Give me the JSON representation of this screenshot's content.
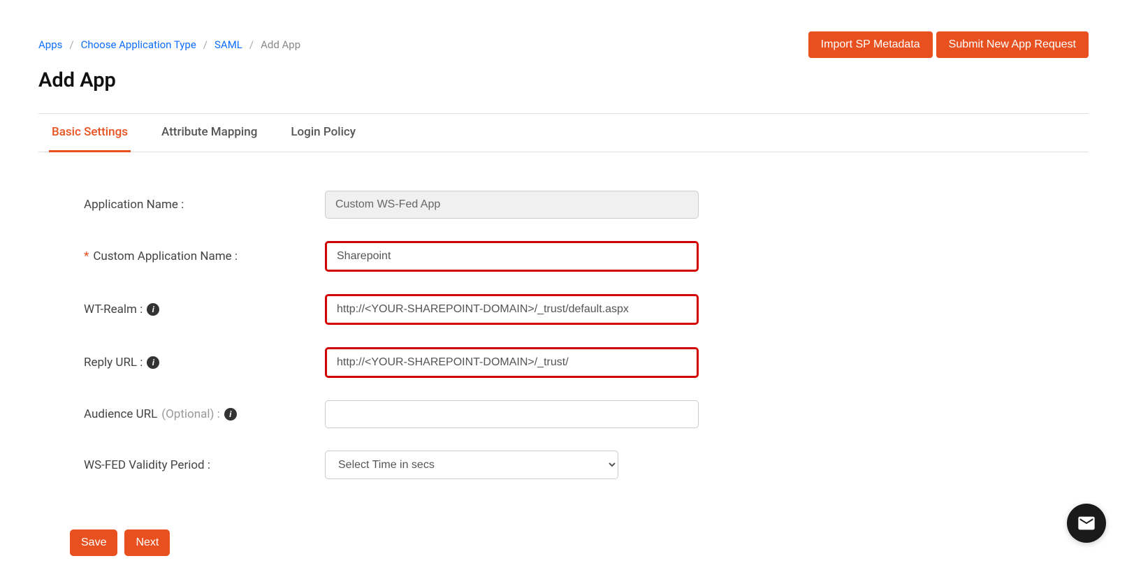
{
  "breadcrumb": {
    "apps": "Apps",
    "choose_type": "Choose Application Type",
    "saml": "SAML",
    "add_app": "Add App"
  },
  "top_buttons": {
    "import_sp": "Import SP Metadata",
    "submit_new": "Submit New App Request"
  },
  "page_title": "Add App",
  "tabs": {
    "basic": "Basic Settings",
    "attribute": "Attribute Mapping",
    "login": "Login Policy"
  },
  "form": {
    "app_name_label": "Application Name :",
    "app_name_value": "Custom WS-Fed App",
    "custom_app_name_label": "Custom Application Name :",
    "custom_app_name_value": "Sharepoint",
    "wt_realm_label": "WT-Realm :",
    "wt_realm_value": "http://<YOUR-SHAREPOINT-DOMAIN>/_trust/default.aspx",
    "reply_url_label": "Reply URL :",
    "reply_url_value": "http://<YOUR-SHAREPOINT-DOMAIN>/_trust/",
    "audience_url_label": "Audience URL",
    "audience_url_optional": "(Optional) :",
    "audience_url_value": "",
    "validity_label": "WS-FED Validity Period :",
    "validity_placeholder": "Select Time in secs"
  },
  "actions": {
    "save": "Save",
    "next": "Next"
  }
}
